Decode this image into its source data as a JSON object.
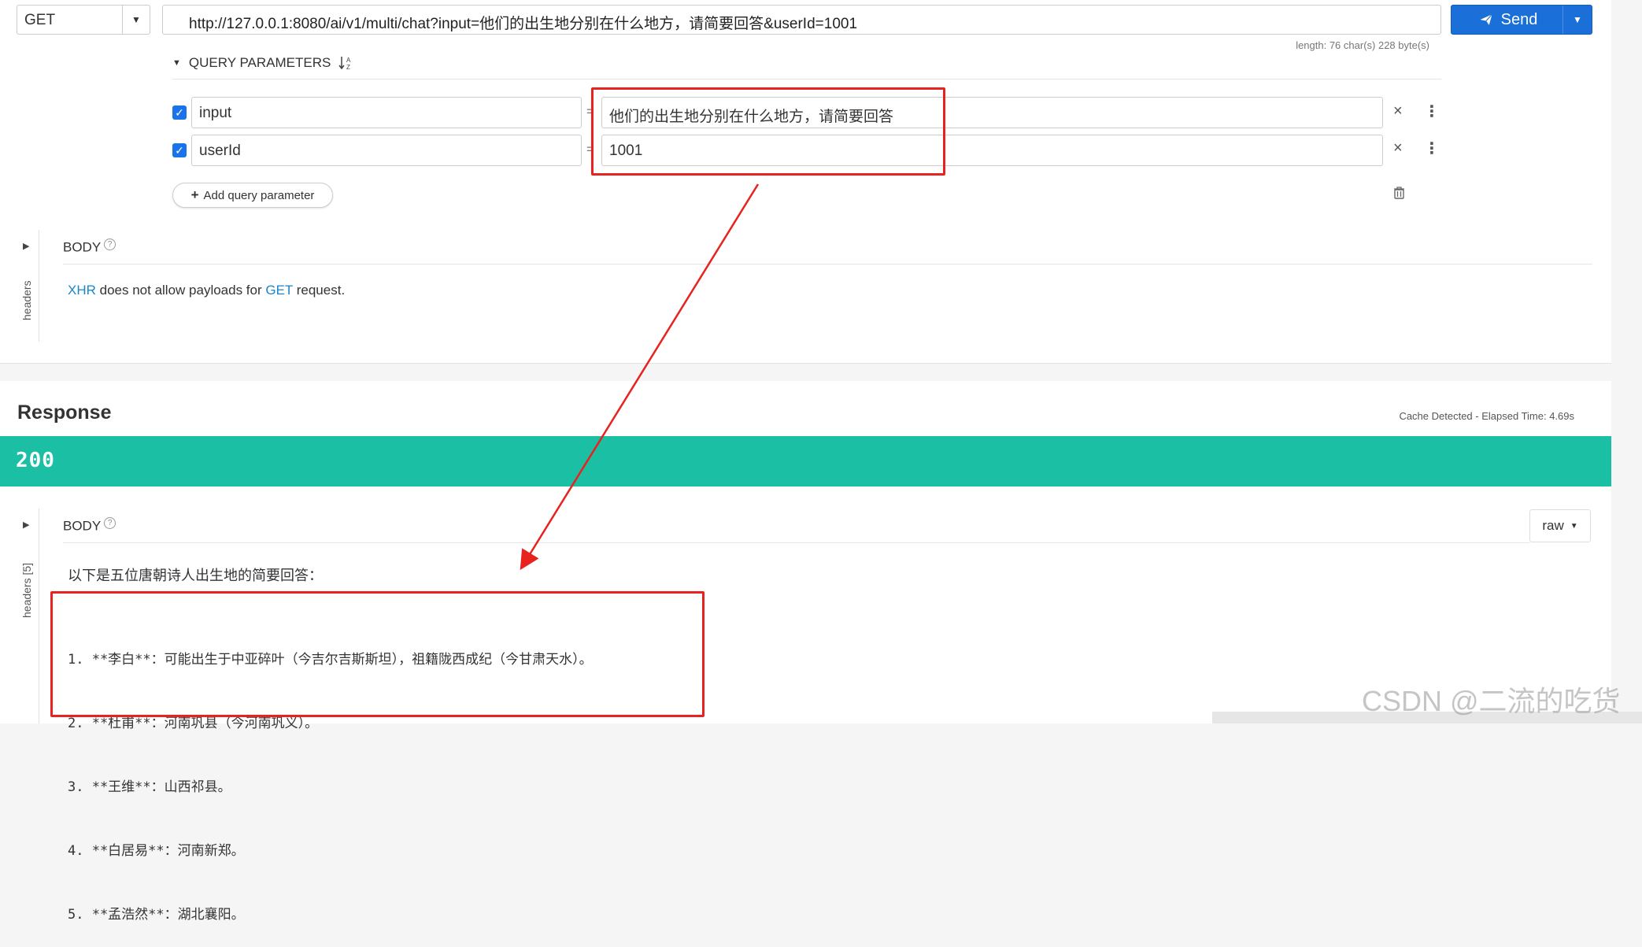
{
  "request": {
    "method": "GET",
    "url": "http://127.0.0.1:8080/ai/v1/multi/chat?input=他们的出生地分别在什么地方，请简要回答&userId=1001",
    "send_label": "Send",
    "length_info": "length: 76 char(s) 228 byte(s)",
    "query_section_label": "QUERY PARAMETERS",
    "params": [
      {
        "name": "input",
        "value": "他们的出生地分别在什么地方，请简要回答",
        "checked": true
      },
      {
        "name": "userId",
        "value": "1001",
        "checked": true
      }
    ],
    "equals_sign": "=",
    "add_param_label": "Add query parameter",
    "body_label": "BODY",
    "headers_tab_label": "headers",
    "payload_note": {
      "part1": "XHR",
      "part2": " does not allow payloads for ",
      "part3": "GET",
      "part4": " request."
    }
  },
  "response": {
    "title": "Response",
    "cache_info": "Cache Detected - Elapsed Time: 4.69s",
    "status_code": "200",
    "status_color": "#1bbfa4",
    "body_label": "BODY",
    "headers_tab_label": "headers [5]",
    "format_label": "raw",
    "intro": "以下是五位唐朝诗人出生地的简要回答：",
    "lines": [
      "1. **李白**：可能出生于中亚碎叶（今吉尔吉斯斯坦），祖籍陇西成纪（今甘肃天水）。",
      "2. **杜甫**：河南巩县（今河南巩义）。",
      "3. **王维**：山西祁县。",
      "4. **白居易**：河南新郑。",
      "5. **孟浩然**：湖北襄阳。"
    ]
  },
  "watermark": "CSDN @二流的吃货",
  "colors": {
    "accent": "#1a6fd8",
    "annotation": "#e8221e"
  },
  "icons": [
    "paper-plane-icon",
    "chevron-down-icon",
    "sort-alpha-icon",
    "close-icon",
    "kebab-menu-icon",
    "trash-icon",
    "plus-icon",
    "help-circle-icon",
    "triangle-expander-icon",
    "checkbox-checked-icon"
  ]
}
